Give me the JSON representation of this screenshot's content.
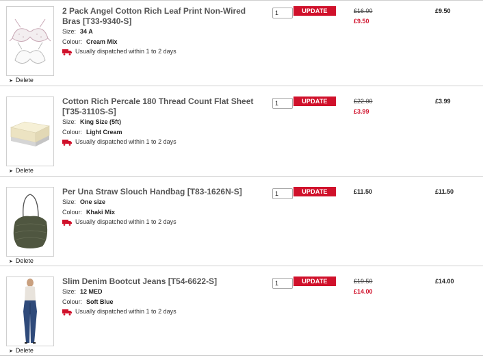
{
  "items": [
    {
      "title": "2 Pack Angel Cotton Rich Leaf Print Non-Wired Bras [T33-9340-S]",
      "size_label": "Size:",
      "size": "34 A",
      "colour_label": "Colour:",
      "colour": "Cream Mix",
      "dispatch": "Usually dispatched within 1 to 2 days",
      "quantity": "1",
      "update_label": "UPDATE",
      "was_price": "£16.00",
      "price": "£9.50",
      "total": "£9.50",
      "delete_label": "Delete",
      "image": "bras-image"
    },
    {
      "title": "Cotton Rich Percale 180 Thread Count Flat Sheet [T35-3110S-S]",
      "size_label": "Size:",
      "size": "King Size (5ft)",
      "colour_label": "Colour:",
      "colour": "Light Cream",
      "dispatch": "Usually dispatched within 1 to 2 days",
      "quantity": "1",
      "update_label": "UPDATE",
      "was_price": "£22.00",
      "price": "£3.99",
      "total": "£3.99",
      "delete_label": "Delete",
      "image": "sheet-image"
    },
    {
      "title": "Per Una Straw Slouch Handbag [T83-1626N-S]",
      "size_label": "Size:",
      "size": "One size",
      "colour_label": "Colour:",
      "colour": "Khaki Mix",
      "dispatch": "Usually dispatched within 1 to 2 days",
      "quantity": "1",
      "update_label": "UPDATE",
      "price": "£11.50",
      "total": "£11.50",
      "delete_label": "Delete",
      "image": "handbag-image"
    },
    {
      "title": "Slim Denim Bootcut Jeans [T54-6622-S]",
      "size_label": "Size:",
      "size": "12 MED",
      "colour_label": "Colour:",
      "colour": "Soft Blue",
      "dispatch": "Usually dispatched within 1 to 2 days",
      "quantity": "1",
      "update_label": "UPDATE",
      "was_price": "£19.50",
      "price": "£14.00",
      "total": "£14.00",
      "delete_label": "Delete",
      "image": "jeans-image"
    }
  ],
  "colors": {
    "accent": "#d0112b",
    "rule": "#cfcfcf"
  }
}
